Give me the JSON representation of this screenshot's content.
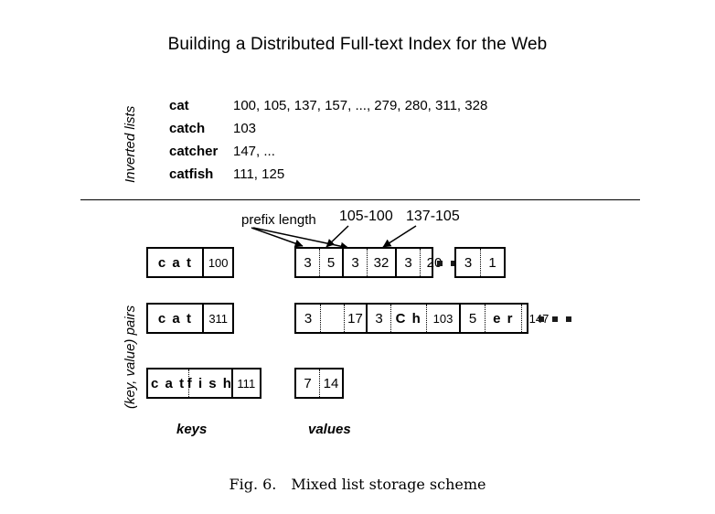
{
  "page": {
    "title": "Building a Distributed Full-text Index for the Web",
    "figure_caption_number": "Fig. 6.",
    "figure_caption_text": "Mixed list storage scheme",
    "background_color": "#ffffff",
    "ink_color": "#000000"
  },
  "sections": {
    "inverted_lists_label": "Inverted lists",
    "kv_pairs_label": "(key, value) pairs"
  },
  "inverted_lists": [
    {
      "term": "cat",
      "postings": "100, 105, 137, 157, ..., 279, 280, 311, 328"
    },
    {
      "term": "catch",
      "postings": "103"
    },
    {
      "term": "catcher",
      "postings": "147, ..."
    },
    {
      "term": "catfish",
      "postings": "111, 125"
    }
  ],
  "annotations": [
    {
      "id": "prefix-length",
      "text": "prefix length"
    },
    {
      "id": "delta-105-100",
      "text": "105-100"
    },
    {
      "id": "delta-137-105",
      "text": "137-105"
    }
  ],
  "column_captions": {
    "keys": "keys",
    "values": "values"
  },
  "key_boxes": [
    {
      "id": "key-box-1",
      "chars": "c a t",
      "docid": "100"
    },
    {
      "id": "key-box-2",
      "chars": "c a t",
      "docid": "311"
    },
    {
      "id": "key-box-3",
      "chars_1": "c a t",
      "chars_2": "f i s h",
      "docid": "111"
    }
  ],
  "value_rows": [
    {
      "id": "val-row-1",
      "groups": [
        {
          "cells": [
            "3",
            "5"
          ]
        },
        {
          "cells": [
            "3",
            "32"
          ]
        },
        {
          "cells": [
            "3",
            "20"
          ]
        }
      ],
      "ellipsis": "•••",
      "tail_group": {
        "cells": [
          "3",
          "1"
        ]
      }
    },
    {
      "id": "val-row-2",
      "groups": [
        {
          "cells": [
            "3",
            "",
            "17"
          ]
        },
        {
          "cells": [
            "3",
            "C h",
            "103"
          ]
        },
        {
          "cells": [
            "5",
            "e r",
            "147"
          ]
        }
      ],
      "ellipsis": "•••",
      "tail_group": null
    },
    {
      "id": "val-row-3",
      "groups": [
        {
          "cells": [
            "7",
            "14"
          ]
        }
      ],
      "ellipsis": "",
      "tail_group": null
    }
  ]
}
